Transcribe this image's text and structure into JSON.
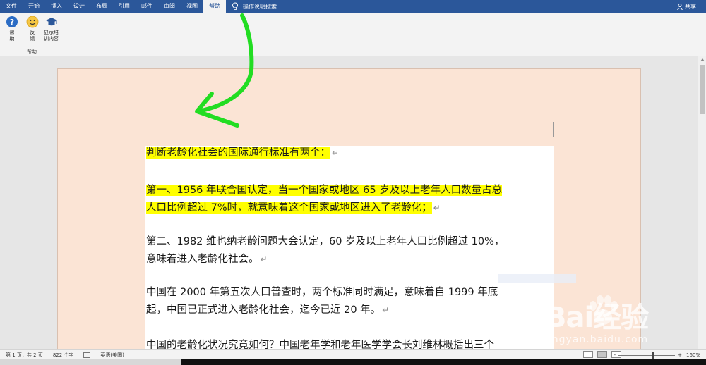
{
  "ribbon": {
    "tabs": [
      "文件",
      "开始",
      "插入",
      "设计",
      "布局",
      "引用",
      "邮件",
      "审阅",
      "视图",
      "帮助"
    ],
    "active_tab": "帮助",
    "tell_me": "操作说明搜索",
    "share": "共享",
    "buttons": {
      "help": "帮\n助",
      "feedback": "反\n馈",
      "training": "显示培\n训内容"
    },
    "group_label": "帮助"
  },
  "document": {
    "paragraphs": [
      {
        "lines": [
          "判断老龄化社会的国际通行标准有两个："
        ],
        "highlight": true
      },
      {
        "lines": [
          "第一、1956 年联合国认定，当一个国家或地区 65 岁及以上老年人口数量占总",
          "人口比例超过 7%时，就意味着这个国家或地区进入了老龄化；"
        ],
        "highlight": true
      },
      {
        "lines": [
          "第二、1982 维也纳老龄问题大会认定，60 岁及以上老年人口比例超过 10%，",
          "意味着进入老龄化社会。"
        ],
        "highlight": false
      },
      {
        "lines": [
          "中国在 2000 年第五次人口普查时，两个标准同时满足，意味着自 1999 年底",
          "起，中国已正式进入老龄化社会，迄今已近 20 年。"
        ],
        "highlight": false
      },
      {
        "lines": [
          "中国的老龄化状况究竟如何？中国老年学和老年医学学会长刘维林概括出三个"
        ],
        "highlight": false
      }
    ],
    "paragraph_mark": "↵"
  },
  "statusbar": {
    "page": "第 1 页，共 2 页",
    "words": "822 个字",
    "language": "英语(美国)",
    "zoom": "160%",
    "zoom_minus": "-",
    "zoom_plus": "+",
    "zoom_level_fraction": 0.6
  },
  "watermark": {
    "brand": "Bai经验",
    "sub": "jingyan.baidu.com"
  },
  "colors": {
    "ribbon_blue": "#2b579a",
    "highlight": "#ffff00",
    "page_color": "#fbe4d5",
    "arrow": "#22dd22"
  }
}
